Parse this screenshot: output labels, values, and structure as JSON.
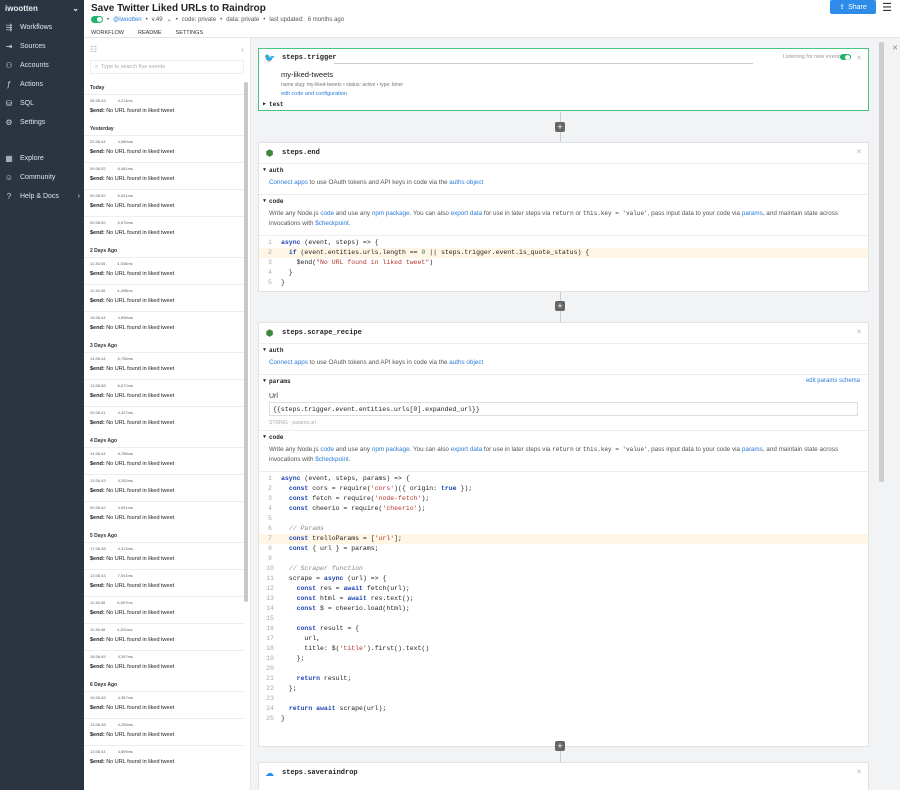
{
  "sidebar": {
    "user": "iwootten",
    "items": [
      {
        "label": "Workflows",
        "icon": "workflow-icon"
      },
      {
        "label": "Sources",
        "icon": "sources-icon"
      },
      {
        "label": "Accounts",
        "icon": "accounts-icon"
      },
      {
        "label": "Actions",
        "icon": "actions-icon"
      },
      {
        "label": "SQL",
        "icon": "sql-icon"
      },
      {
        "label": "Settings",
        "icon": "settings-icon"
      }
    ],
    "items2": [
      {
        "label": "Explore",
        "icon": "explore-icon"
      },
      {
        "label": "Community",
        "icon": "community-icon"
      },
      {
        "label": "Help & Docs",
        "icon": "help-icon"
      }
    ]
  },
  "header": {
    "title": "Save Twitter Liked URLs to Raindrop",
    "owner": "@iwootten",
    "version": "v.49",
    "code": "code: private",
    "data": "data: private",
    "updated_prefix": "last updated:",
    "updated": "6 months ago",
    "tabs": [
      "WORKFLOW",
      "README",
      "SETTINGS"
    ],
    "share": "Share"
  },
  "events": {
    "search_placeholder": "Type to search five events",
    "groups": [
      {
        "day": "Today",
        "rows": [
          {
            "time": "08:36:43",
            "ms": "4,211ms",
            "msg": "No URL found in liked tweet"
          }
        ]
      },
      {
        "day": "Yesterday",
        "rows": [
          {
            "time": "22:36:44",
            "ms": "4,589ms",
            "msg": "No URL found in liked tweet"
          },
          {
            "time": "09:36:52",
            "ms": "6,481ms",
            "msg": "No URL found in liked tweet"
          },
          {
            "time": "09:36:52",
            "ms": "6,641ms",
            "msg": "No URL found in liked tweet"
          },
          {
            "time": "09:36:52",
            "ms": "6,576ms",
            "msg": "No URL found in liked tweet"
          }
        ]
      },
      {
        "day": "2 Days Ago",
        "rows": [
          {
            "time": "11:36:45",
            "ms": "4,536ms",
            "msg": "No URL found in liked tweet"
          },
          {
            "time": "11:36:45",
            "ms": "4,498ms",
            "msg": "No URL found in liked tweet"
          },
          {
            "time": "18:36:44",
            "ms": "4,898ms",
            "msg": "No URL found in liked tweet"
          }
        ]
      },
      {
        "day": "3 Days Ago",
        "rows": [
          {
            "time": "14:36:44",
            "ms": "6,758ms",
            "msg": "No URL found in liked tweet"
          },
          {
            "time": "13:36:58",
            "ms": "6,672ms",
            "msg": "No URL found in liked tweet"
          },
          {
            "time": "09:36:41",
            "ms": "4,427ms",
            "msg": "No URL found in liked tweet"
          }
        ]
      },
      {
        "day": "4 Days Ago",
        "rows": [
          {
            "time": "14:36:44",
            "ms": "8,788ms",
            "msg": "No URL found in liked tweet"
          },
          {
            "time": "13:36:43",
            "ms": "4,252ms",
            "msg": "No URL found in liked tweet"
          },
          {
            "time": "09:36:42",
            "ms": "4,991ms",
            "msg": "No URL found in liked tweet"
          }
        ]
      },
      {
        "day": "5 Days Ago",
        "rows": [
          {
            "time": "17:36:48",
            "ms": "4,313ms",
            "msg": "No URL found in liked tweet"
          },
          {
            "time": "13:36:43",
            "ms": "7,544ms",
            "msg": "No URL found in liked tweet"
          },
          {
            "time": "11:36:48",
            "ms": "6,897ms",
            "msg": "No URL found in liked tweet"
          },
          {
            "time": "11:36:48",
            "ms": "4,511ms",
            "msg": "No URL found in liked tweet"
          },
          {
            "time": "18:36:45",
            "ms": "4,397ms",
            "msg": "No URL found in liked tweet"
          }
        ]
      },
      {
        "day": "6 Days Ago",
        "rows": [
          {
            "time": "16:36:45",
            "ms": "4,387ms",
            "msg": "No URL found in liked tweet"
          },
          {
            "time": "13:36:48",
            "ms": "4,256ms",
            "msg": "No URL found in liked tweet"
          },
          {
            "time": "13:36:44",
            "ms": "4,899ms",
            "msg": "No URL found in liked tweet"
          }
        ]
      }
    ]
  },
  "trigger": {
    "name": "steps.trigger",
    "listening": "Listening for new events",
    "title": "my-liked-tweets",
    "meta": "name slug: my-liked-tweets  •  status: active  •  type: timer",
    "edit": "edit code and configuration",
    "test": "test"
  },
  "end": {
    "name": "steps.end",
    "auth": "auth",
    "code": "code"
  },
  "scrape": {
    "name": "steps.scrape_recipe",
    "auth": "auth",
    "params": "params",
    "edit_params": "edit params schema",
    "url_label": "Url",
    "url_value": "{{steps.trigger.event.entities.urls[0].expanded_url}}",
    "url_hint": "STRING · params.url",
    "code": "code"
  },
  "saveraindrop": {
    "name": "steps.saveraindrop"
  },
  "auth_text": {
    "a": "Connect apps",
    "b": " to use OAuth tokens and API keys in code via the ",
    "c": "auths object"
  },
  "code_text": {
    "a": "Write any Node.js ",
    "b": "code",
    "c": " and use any ",
    "d": "npm package",
    "e": ". You can also ",
    "f": "export data",
    "g": " for use in later steps via ",
    "h": "return",
    "i": " or ",
    "j": "this.key = 'value'",
    "k": ", pass input data to your code via ",
    "l": "params",
    "m": ", and maintain state across invocations with ",
    "n": "$checkpoint",
    "o": "."
  }
}
